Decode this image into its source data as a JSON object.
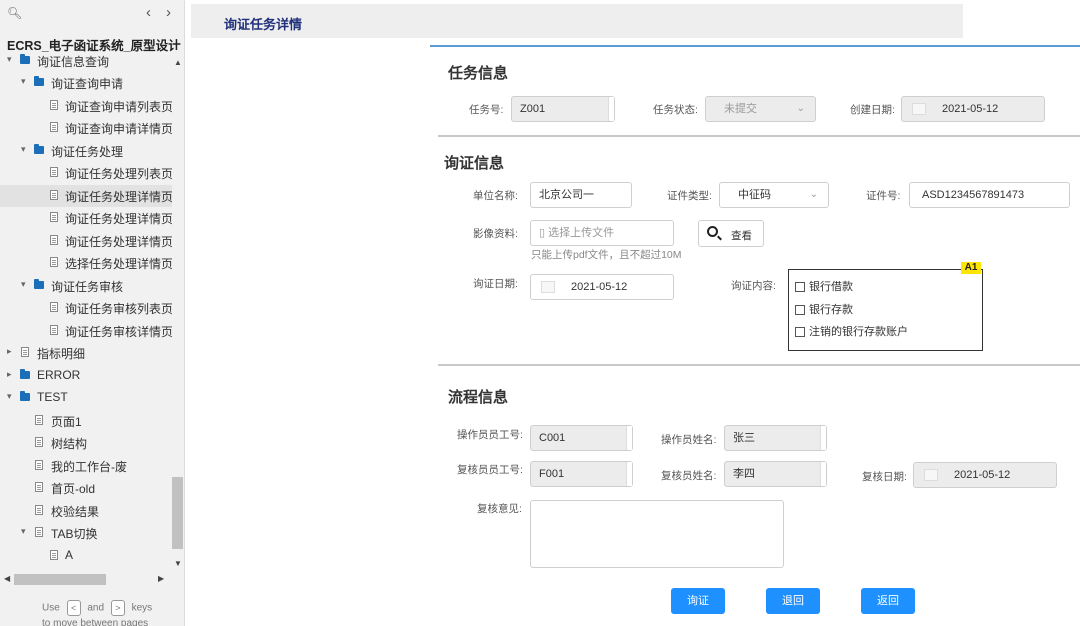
{
  "sidebar": {
    "project_title": "ECRS_电子函证系统_原型设计",
    "items": [
      {
        "label": "询证信息查询"
      },
      {
        "label": "询证查询申请"
      },
      {
        "label": "询证查询申请列表页"
      },
      {
        "label": "询证查询申请详情页"
      },
      {
        "label": "询证任务处理"
      },
      {
        "label": "询证任务处理列表页"
      },
      {
        "label": "询证任务处理详情页"
      },
      {
        "label": "询证任务处理详情页"
      },
      {
        "label": "询证任务处理详情页"
      },
      {
        "label": "选择任务处理详情页"
      },
      {
        "label": "询证任务审核"
      },
      {
        "label": "询证任务审核列表页"
      },
      {
        "label": "询证任务审核详情页"
      },
      {
        "label": "指标明细"
      },
      {
        "label": "ERROR"
      },
      {
        "label": "TEST"
      },
      {
        "label": "页面1"
      },
      {
        "label": "树结构"
      },
      {
        "label": "我的工作台-废"
      },
      {
        "label": "首页-old"
      },
      {
        "label": "校验结果"
      },
      {
        "label": "TAB切换"
      },
      {
        "label": "A"
      }
    ],
    "hint": {
      "use": "Use",
      "and": "and",
      "keys": "keys",
      "key1": "<",
      "key2": ">",
      "line2": "to move between pages"
    }
  },
  "header": {
    "title": "询证任务详情"
  },
  "task_info": {
    "title": "任务信息",
    "task_no_label": "任务号:",
    "task_no": "Z001",
    "status_label": "任务状态:",
    "status": "未提交",
    "created_label": "创建日期:",
    "created": "2021-05-12"
  },
  "verify_info": {
    "title": "询证信息",
    "unit_label": "单位名称:",
    "unit": "北京公司一",
    "cert_type_label": "证件类型:",
    "cert_type": "中征码",
    "cert_no_label": "证件号:",
    "cert_no": "ASD1234567891473",
    "image_label": "影像资料:",
    "upload_placeholder": "▯ 选择上传文件",
    "view_label": "查看",
    "upload_hint": "只能上传pdf文件，且不超过10M",
    "date_label": "询证日期:",
    "date": "2021-05-12",
    "content_label": "询证内容:",
    "badge": "A1",
    "options": [
      "银行借款",
      "银行存款",
      "注销的银行存款账户"
    ]
  },
  "flow_info": {
    "title": "流程信息",
    "op_id_label": "操作员员工号:",
    "op_id": "C001",
    "op_name_label": "操作员姓名:",
    "op_name": "张三",
    "rev_id_label": "复核员员工号:",
    "rev_id": "F001",
    "rev_name_label": "复核员姓名:",
    "rev_name": "李四",
    "rev_date_label": "复核日期:",
    "rev_date": "2021-05-12",
    "opinion_label": "复核意见:"
  },
  "buttons": {
    "verify": "询证",
    "back1": "退回",
    "back2": "返回"
  },
  "colors": {
    "accent": "#1e90ff",
    "header_text": "#1f2f7a",
    "folder": "#1a6fb8",
    "badge": "#ffe600"
  }
}
